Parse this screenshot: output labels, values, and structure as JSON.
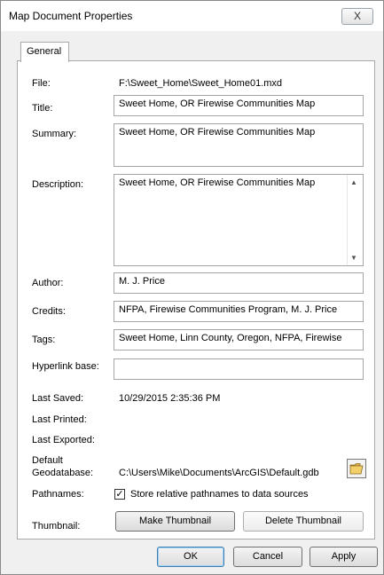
{
  "window": {
    "title": "Map Document Properties",
    "close_glyph": "X"
  },
  "tabs": [
    {
      "label": "General"
    }
  ],
  "labels": {
    "file": "File:",
    "title": "Title:",
    "summary": "Summary:",
    "description": "Description:",
    "author": "Author:",
    "credits": "Credits:",
    "tags": "Tags:",
    "hyperlink": "Hyperlink base:",
    "last_saved": "Last Saved:",
    "last_printed": "Last Printed:",
    "last_exported": "Last Exported:",
    "default_gdb_line1": "Default",
    "default_gdb_line2": "Geodatabase:",
    "pathnames": "Pathnames:",
    "thumbnail": "Thumbnail:"
  },
  "values": {
    "file": "F:\\Sweet_Home\\Sweet_Home01.mxd",
    "title": "Sweet Home, OR Firewise Communities Map",
    "summary": "Sweet Home, OR Firewise Communities Map",
    "description": "Sweet Home, OR Firewise Communities Map",
    "author": "M. J. Price",
    "credits": "NFPA, Firewise Communities Program, M. J. Price",
    "tags": "Sweet Home, Linn County, Oregon, NFPA, Firewise",
    "hyperlink": "",
    "last_saved": "10/29/2015 2:35:36 PM",
    "last_printed": "",
    "last_exported": "",
    "default_gdb": "C:\\Users\\Mike\\Documents\\ArcGIS\\Default.gdb"
  },
  "pathnames": {
    "checked": true,
    "label": "Store relative pathnames to data sources",
    "check_glyph": "✓"
  },
  "scroll": {
    "up": "▲",
    "down": "▼"
  },
  "thumbnail_buttons": {
    "make": "Make Thumbnail",
    "delete": "Delete Thumbnail"
  },
  "footer": {
    "ok": "OK",
    "cancel": "Cancel",
    "apply": "Apply"
  },
  "icons": {
    "browse": "folder-icon"
  }
}
